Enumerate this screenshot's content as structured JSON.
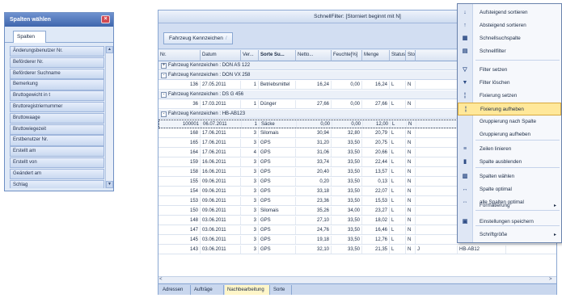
{
  "columns_panel": {
    "title": "Spalten wählen",
    "close_glyph": "×",
    "tab_label": "Spalten",
    "items": [
      "Änderungsbenutzer Nr.",
      "Beförderer Nr.",
      "Beförderer Suchname",
      "Bemerkung",
      "Bruttogewicht in t",
      "Bruttoregistriernummer",
      "Bruttowaage",
      "Bruttowiegezeit",
      "Erstbenutzer Nr.",
      "Erstellt am",
      "Erstellt von",
      "Geändert am",
      "Schlag"
    ]
  },
  "main": {
    "title": "SchnellFilter: [Storniert beginnt mit N]",
    "group_chip": "Fahrzeug Kennzeichen",
    "group_chip_x": "/",
    "headers": [
      "Nr.",
      "Datum",
      "Ver...",
      "Sorte Su...",
      "Netto...",
      "Feuchte[%]",
      "Menge",
      "Status",
      "Stor..."
    ],
    "rows": [
      {
        "type": "group",
        "toggle": "+",
        "text": "Fahrzeug Kennzeichen : DON AS 122"
      },
      {
        "type": "group",
        "toggle": "-",
        "text": "Fahrzeug Kennzeichen : DON VX 258"
      },
      {
        "type": "data",
        "cells": [
          "136",
          "27.05.2011",
          "1",
          "Betriebsmittel",
          "16,24",
          "0,00",
          "16,24",
          "L",
          "N"
        ]
      },
      {
        "type": "group",
        "toggle": "-",
        "text": "Fahrzeug Kennzeichen : DS G 456"
      },
      {
        "type": "data",
        "cells": [
          "36",
          "17.03.2011",
          "1",
          "Dünger",
          "27,66",
          "0,00",
          "27,66",
          "L",
          "N"
        ]
      },
      {
        "type": "group",
        "toggle": "-",
        "text": "Fahrzeug Kennzeichen : HB-AB123"
      },
      {
        "type": "data",
        "selected": true,
        "cells": [
          "100001",
          "06.07.2011",
          "1",
          "Säcke",
          "0,00",
          "0,00",
          "12,00",
          "L",
          "N"
        ]
      },
      {
        "type": "data",
        "cells": [
          "168",
          "17.06.2011",
          "3",
          "Silomais",
          "30,94",
          "32,80",
          "20,79",
          "L",
          "N"
        ]
      },
      {
        "type": "data",
        "cells": [
          "165",
          "17.06.2011",
          "3",
          "GPS",
          "31,20",
          "33,50",
          "20,75",
          "L",
          "N"
        ]
      },
      {
        "type": "data",
        "cells": [
          "164",
          "17.06.2011",
          "4",
          "GPS",
          "31,06",
          "33,50",
          "20,66",
          "L",
          "N"
        ]
      },
      {
        "type": "data",
        "cells": [
          "159",
          "16.06.2011",
          "3",
          "GPS",
          "33,74",
          "33,50",
          "22,44",
          "L",
          "N"
        ]
      },
      {
        "type": "data",
        "cells": [
          "158",
          "16.06.2011",
          "3",
          "GPS",
          "20,40",
          "33,50",
          "13,57",
          "L",
          "N"
        ]
      },
      {
        "type": "data",
        "cells": [
          "155",
          "09.06.2011",
          "3",
          "GPS",
          "0,20",
          "33,50",
          "0,13",
          "L",
          "N"
        ]
      },
      {
        "type": "data",
        "cells": [
          "154",
          "09.06.2011",
          "3",
          "GPS",
          "33,18",
          "33,50",
          "22,07",
          "L",
          "N"
        ]
      },
      {
        "type": "data",
        "cells": [
          "153",
          "09.06.2011",
          "3",
          "GPS",
          "23,36",
          "33,50",
          "15,53",
          "L",
          "N"
        ]
      },
      {
        "type": "data",
        "cells": [
          "150",
          "09.06.2011",
          "3",
          "Silomais",
          "35,26",
          "34,00",
          "23,27",
          "L",
          "N"
        ]
      },
      {
        "type": "data",
        "cells": [
          "148",
          "03.06.2011",
          "3",
          "GPS",
          "27,10",
          "33,50",
          "18,02",
          "L",
          "N"
        ]
      },
      {
        "type": "data",
        "cells": [
          "147",
          "03.06.2011",
          "3",
          "GPS",
          "24,76",
          "33,50",
          "16,46",
          "L",
          "N"
        ]
      },
      {
        "type": "data",
        "cells": [
          "145",
          "03.06.2011",
          "3",
          "GPS",
          "19,18",
          "33,50",
          "12,76",
          "L",
          "N"
        ]
      },
      {
        "type": "data",
        "cells": [
          "143",
          "03.06.2011",
          "3",
          "GPS",
          "32,10",
          "33,50",
          "21,35",
          "L",
          "N",
          "J",
          "HB-AB12"
        ]
      }
    ],
    "hscroll_left": "<",
    "hscroll_right": ">",
    "bottom_tabs": [
      "Adressen",
      "Aufträge",
      "Nachbearbeitung",
      "Sorte"
    ],
    "active_tab": "Nachbearbeitung"
  },
  "context_menu": {
    "items": [
      {
        "label": "Aufsteigend sortieren",
        "icon": "sort-ascending-icon",
        "glyph": "↓"
      },
      {
        "label": "Absteigend sortieren",
        "icon": "sort-descending-icon",
        "glyph": "↑"
      },
      {
        "label": "Schnellsuchspalte",
        "icon": "quick-search-icon",
        "glyph": "▦"
      },
      {
        "label": "Schnellfilter",
        "icon": "quick-filter-icon",
        "glyph": "▤"
      },
      {
        "label": "Filter setzen",
        "icon": "filter-set-icon",
        "glyph": "▽"
      },
      {
        "label": "Filter löschen",
        "icon": "filter-clear-icon",
        "glyph": "▼"
      },
      {
        "label": "Fixierung setzen",
        "icon": "pin-icon",
        "glyph": "¦"
      },
      {
        "label": "Fixierung aufheben",
        "icon": "unpin-icon",
        "glyph": "¦",
        "highlighted": true
      },
      {
        "label": "Gruppierung nach Spalte",
        "icon": "",
        "glyph": ""
      },
      {
        "label": "Gruppierung aufheben",
        "icon": "",
        "glyph": ""
      },
      {
        "label": "Zeilen linieren",
        "icon": "row-lines-icon",
        "glyph": "≡"
      },
      {
        "label": "Spalte ausblenden",
        "icon": "hide-column-icon",
        "glyph": "▮"
      },
      {
        "label": "Spalten wählen",
        "icon": "choose-columns-icon",
        "glyph": "▥"
      },
      {
        "label": "Spalte optimal",
        "icon": "column-optimal-icon",
        "glyph": "↔"
      },
      {
        "label": "alle Spalten optimal",
        "icon": "all-columns-optimal-icon",
        "glyph": "⇔"
      },
      {
        "label": "Formatierung",
        "icon": "",
        "glyph": "",
        "submenu": true
      },
      {
        "label": "Einstellungen speichern",
        "icon": "save-settings-icon",
        "glyph": "▣"
      },
      {
        "label": "Schriftgröße",
        "icon": "",
        "glyph": "",
        "submenu": true
      }
    ],
    "submenu_arrow": "▸"
  }
}
